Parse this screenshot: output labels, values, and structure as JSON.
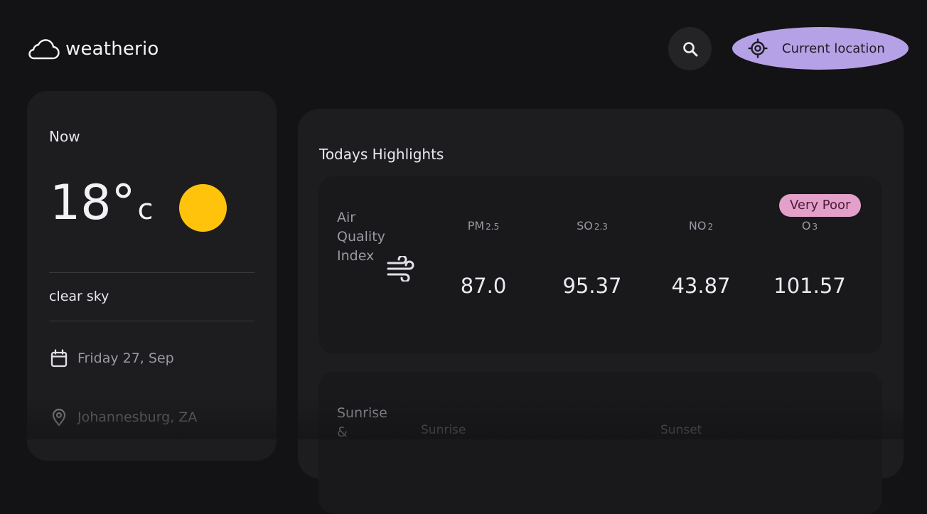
{
  "app": {
    "name": "weatherio"
  },
  "header": {
    "search_icon": "search-icon",
    "current_location_label": "Current location",
    "accent_color": "#b5a1e5"
  },
  "now": {
    "title": "Now",
    "temperature": "18°",
    "unit": "c",
    "description": "clear sky",
    "date": "Friday 27, Sep",
    "location": "Johannesburg, ZA",
    "weather_icon": "sun-icon"
  },
  "highlights": {
    "title": "Todays Highlights",
    "air_quality": {
      "title": "Air Quality Index",
      "status": "Very Poor",
      "status_color": "#e3a0c8",
      "pollutants": [
        {
          "name": "PM",
          "sub": "2.5",
          "value": "87.0"
        },
        {
          "name": "SO",
          "sub": "2.3",
          "value": "95.37"
        },
        {
          "name": "NO",
          "sub": "2",
          "value": "43.87"
        },
        {
          "name": "O",
          "sub": "3",
          "value": "101.57"
        }
      ]
    },
    "sunrise_sunset": {
      "title": "Sunrise &",
      "sunrise_label": "Sunrise",
      "sunset_label": "Sunset"
    }
  }
}
